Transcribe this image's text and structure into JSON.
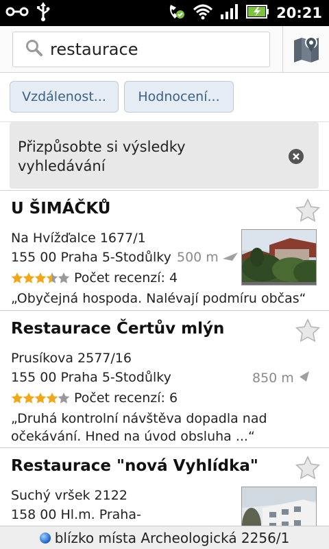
{
  "status_bar": {
    "time": "20:21",
    "icons": [
      "usb-debug-icon",
      "usb-icon",
      "phone-signal-icon",
      "wifi-icon",
      "cell-signal-icon",
      "battery-charging-icon"
    ]
  },
  "search": {
    "query": "restaurace",
    "icon": "search-icon",
    "map_icon": "map-icon"
  },
  "filters": [
    {
      "label": "Vzdálenost..."
    },
    {
      "label": "Hodnocení..."
    }
  ],
  "banner": {
    "text": "Přizpůsobte si výsledky vyhledávání",
    "close_icon": "close-icon"
  },
  "results": [
    {
      "title": "U ŠIMÁČKŮ",
      "street": "Na Hvížďalce 1677/1",
      "city": "155 00 Praha 5-Stodůlky",
      "distance": "500 m",
      "rating": 3.5,
      "reviews": "Počet recenzí: 4",
      "snippet": "„Obyčejná hospoda. Nalévají podmíru občas“",
      "has_photo": true
    },
    {
      "title": "Restaurace Čertův mlýn",
      "street": "Prusíkova 2577/16",
      "city": "155 00 Praha 5-Stodůlky",
      "distance": "850 m",
      "rating": 4,
      "reviews": "Počet recenzí: 6",
      "snippet_1": "„Druhá kontrolní návštěva dopadla nad",
      "snippet_2": "očekávání. Hned na úvod obsluha ...“",
      "has_photo": false
    },
    {
      "title": "Restaurace \"nová Vyhlídka\"",
      "street": "Suchý vršek 2122",
      "city": "158 00 Hl.m. Praha-",
      "has_photo": true
    }
  ],
  "bottom": {
    "location": "blízko místa Archeologická 2256/1"
  },
  "colors": {
    "star_gold": "#f0a818",
    "star_gray": "#9a9a9a",
    "chip_text": "#3a5f8a"
  }
}
